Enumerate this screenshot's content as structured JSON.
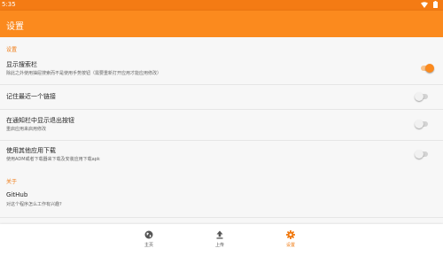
{
  "status_bar": {
    "time": "5:35"
  },
  "app_bar": {
    "title": "设置"
  },
  "sections": [
    {
      "header": "设置"
    },
    {
      "header": "关于"
    }
  ],
  "settings": [
    {
      "title": "显示搜索栏",
      "summary": "除此之外使用抽屉搜索而不是使用手势按钮（需要重新打开应用才能应用修改）",
      "enabled": true
    },
    {
      "title": "记住最近一个链接",
      "summary": "",
      "enabled": false
    },
    {
      "title": "在通知栏中显示退出按钮",
      "summary": "重启应用来启用修改",
      "enabled": false
    },
    {
      "title": "使用其他应用下载",
      "summary": "使用ADM或者下载器来下载及安装应用下载apk",
      "enabled": false
    }
  ],
  "about": [
    {
      "title": "GitHub",
      "summary": "对这个程序怎么工作有兴趣?"
    }
  ],
  "bottom_nav": [
    {
      "label": "主页",
      "icon": "globe-icon",
      "active": false
    },
    {
      "label": "上传",
      "icon": "upload-icon",
      "active": false
    },
    {
      "label": "设置",
      "icon": "gear-icon",
      "active": true
    }
  ],
  "colors": {
    "accent": "#fb8a1e",
    "status_bar": "#f47b14"
  }
}
